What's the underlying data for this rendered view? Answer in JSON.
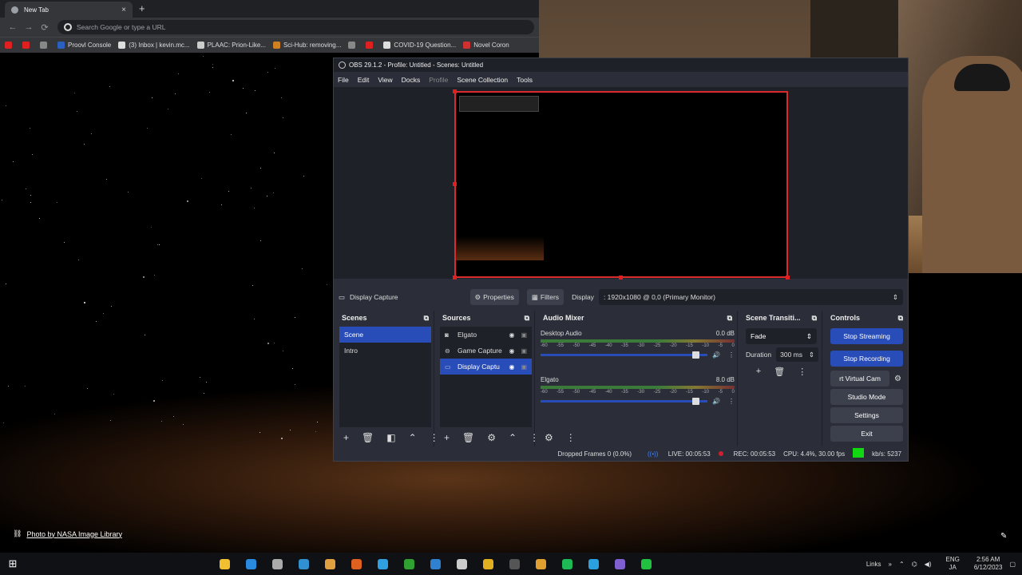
{
  "browser": {
    "tab_title": "New Tab",
    "tab_close": "×",
    "new_tab": "+",
    "omnibox_placeholder": "Search Google or type a URL",
    "nav": {
      "back": "←",
      "forward": "→",
      "reload": "⟳"
    },
    "bookmarks": [
      {
        "label": "",
        "color": "#e02020"
      },
      {
        "label": "",
        "color": "#e02020"
      },
      {
        "label": "",
        "color": "#888"
      },
      {
        "label": "Proovl Console",
        "color": "#2a60c0"
      },
      {
        "label": "(3) Inbox | kevin.mc...",
        "color": "#ddd"
      },
      {
        "label": "PLAAC: Prion-Like...",
        "color": "#ccc"
      },
      {
        "label": "Sci-Hub: removing...",
        "color": "#d08020"
      },
      {
        "label": "",
        "color": "#888"
      },
      {
        "label": "",
        "color": "#e02020"
      },
      {
        "label": "COVID-19 Question...",
        "color": "#ddd"
      },
      {
        "label": "Novel Coron",
        "color": "#d03030"
      }
    ]
  },
  "obs": {
    "window_title": "OBS 29.1.2 - Profile: Untitled - Scenes: Untitled",
    "menu": [
      "File",
      "Edit",
      "View",
      "Docks",
      "Profile",
      "Scene Collection",
      "Tools"
    ],
    "source_toolbar": {
      "selected_source": "Display Capture",
      "properties": "Properties",
      "filters": "Filters",
      "display_label": "Display",
      "display_value": ": 1920x1080 @ 0,0 (Primary Monitor)"
    },
    "scenes": {
      "title": "Scenes",
      "items": [
        {
          "label": "Scene",
          "selected": true
        },
        {
          "label": "Intro",
          "selected": false
        }
      ]
    },
    "sources": {
      "title": "Sources",
      "items": [
        {
          "label": "Elgato",
          "icon": "camera-icon",
          "selected": false
        },
        {
          "label": "Game Capture",
          "icon": "gamepad-icon",
          "selected": false
        },
        {
          "label": "Display Captu",
          "icon": "monitor-icon",
          "selected": true
        }
      ]
    },
    "audio_mixer": {
      "title": "Audio Mixer",
      "channels": [
        {
          "name": "Desktop Audio",
          "level": "0.0 dB",
          "volume": 0.95
        },
        {
          "name": "Elgato",
          "level": "8.0 dB",
          "volume": 0.95
        }
      ],
      "scale": [
        "-60",
        "-55",
        "-50",
        "-45",
        "-40",
        "-35",
        "-30",
        "-25",
        "-20",
        "-15",
        "-10",
        "-5",
        "0"
      ]
    },
    "transitions": {
      "title": "Scene Transiti...",
      "type": "Fade",
      "duration_label": "Duration",
      "duration_value": "300 ms"
    },
    "controls": {
      "title": "Controls",
      "buttons": [
        "Stop Streaming",
        "Stop Recording",
        "rt Virtual Cam",
        "Studio Mode",
        "Settings",
        "Exit"
      ]
    },
    "status": {
      "dropped": "Dropped Frames 0 (0.0%)",
      "live": "LIVE: 00:05:53",
      "rec": "REC: 00:05:53",
      "cpu": "CPU: 4.4%, 30.00 fps",
      "kbs": "kb/s: 5237"
    }
  },
  "desktop": {
    "photo_credit": "Photo by NASA Image Library"
  },
  "taskbar": {
    "icons": [
      {
        "name": "file-explorer-icon",
        "color": "#f0c030"
      },
      {
        "name": "edge-icon",
        "color": "#2a8ae0"
      },
      {
        "name": "settings-gear-icon",
        "color": "#aaa"
      },
      {
        "name": "photos-icon",
        "color": "#3090d0"
      },
      {
        "name": "app-icon",
        "color": "#e0a040"
      },
      {
        "name": "firefox-icon",
        "color": "#e06020"
      },
      {
        "name": "telegram-icon",
        "color": "#30a0e0"
      },
      {
        "name": "terminal-icon",
        "color": "#30a030"
      },
      {
        "name": "mail-icon",
        "color": "#3080d0"
      },
      {
        "name": "app2-icon",
        "color": "#ccc"
      },
      {
        "name": "chrome-icon",
        "color": "#e0b020"
      },
      {
        "name": "obs-icon",
        "color": "#555"
      },
      {
        "name": "app3-icon",
        "color": "#e0a030"
      },
      {
        "name": "spotify-icon",
        "color": "#1db954"
      },
      {
        "name": "skype-icon",
        "color": "#2aa0e0"
      },
      {
        "name": "discord-icon",
        "color": "#8060d0"
      },
      {
        "name": "app4-icon",
        "color": "#20c040"
      }
    ],
    "links": "Links",
    "lang": "ENG",
    "lang2": "JA",
    "time": "2:56 AM",
    "date": "6/12/2023"
  }
}
